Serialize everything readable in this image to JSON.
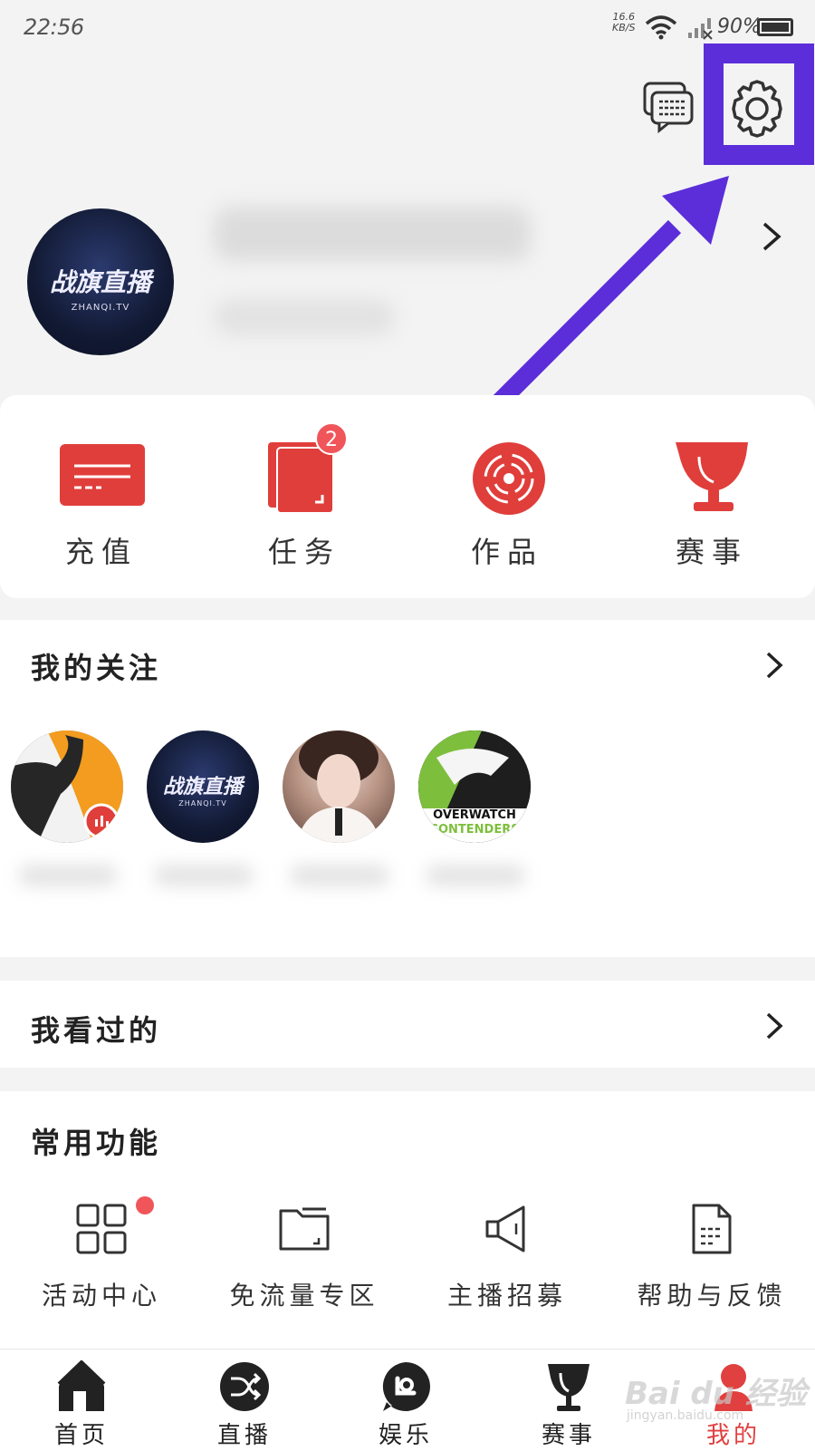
{
  "status_bar": {
    "time": "22:56",
    "speed_value": "16.6",
    "speed_unit": "KB/S",
    "battery": "90%"
  },
  "top_icons": {
    "message": "message-icon",
    "settings": "gear-icon"
  },
  "profile": {
    "avatar_logo": "战旗直播",
    "avatar_sub": "ZHANQI.TV"
  },
  "quick_actions": [
    {
      "label": "充值",
      "icon": "card-icon"
    },
    {
      "label": "任务",
      "icon": "task-icon",
      "badge": "2"
    },
    {
      "label": "作品",
      "icon": "disc-icon"
    },
    {
      "label": "赛事",
      "icon": "trophy-icon"
    }
  ],
  "follow": {
    "title": "我的关注",
    "avatars": [
      {
        "kind": "orange-runner"
      },
      {
        "kind": "zhanqi",
        "logo": "战旗直播",
        "sub": "ZHANQI.TV"
      },
      {
        "kind": "girl"
      },
      {
        "kind": "overwatch",
        "line1": "OVERWATCH",
        "line2": "CONTENDERS"
      }
    ]
  },
  "history": {
    "title": "我看过的"
  },
  "functions": {
    "title": "常用功能",
    "items": [
      {
        "label": "活动中心",
        "icon": "grid-icon"
      },
      {
        "label": "免流量专区",
        "icon": "folder-icon"
      },
      {
        "label": "主播招募",
        "icon": "speaker-icon"
      },
      {
        "label": "帮助与反馈",
        "icon": "document-icon"
      }
    ]
  },
  "bottom_nav": [
    {
      "label": "首页",
      "icon": "home-icon"
    },
    {
      "label": "直播",
      "icon": "shuffle-icon"
    },
    {
      "label": "娱乐",
      "icon": "chat-bubble-icon"
    },
    {
      "label": "赛事",
      "icon": "trophy-icon"
    },
    {
      "label": "我的",
      "icon": "person-icon",
      "active": true
    }
  ],
  "watermark": {
    "main": "Bai du 经验",
    "sub": "jingyan.baidu.com"
  },
  "colors": {
    "accent": "#e0403f",
    "highlight": "#5b2ed9"
  }
}
